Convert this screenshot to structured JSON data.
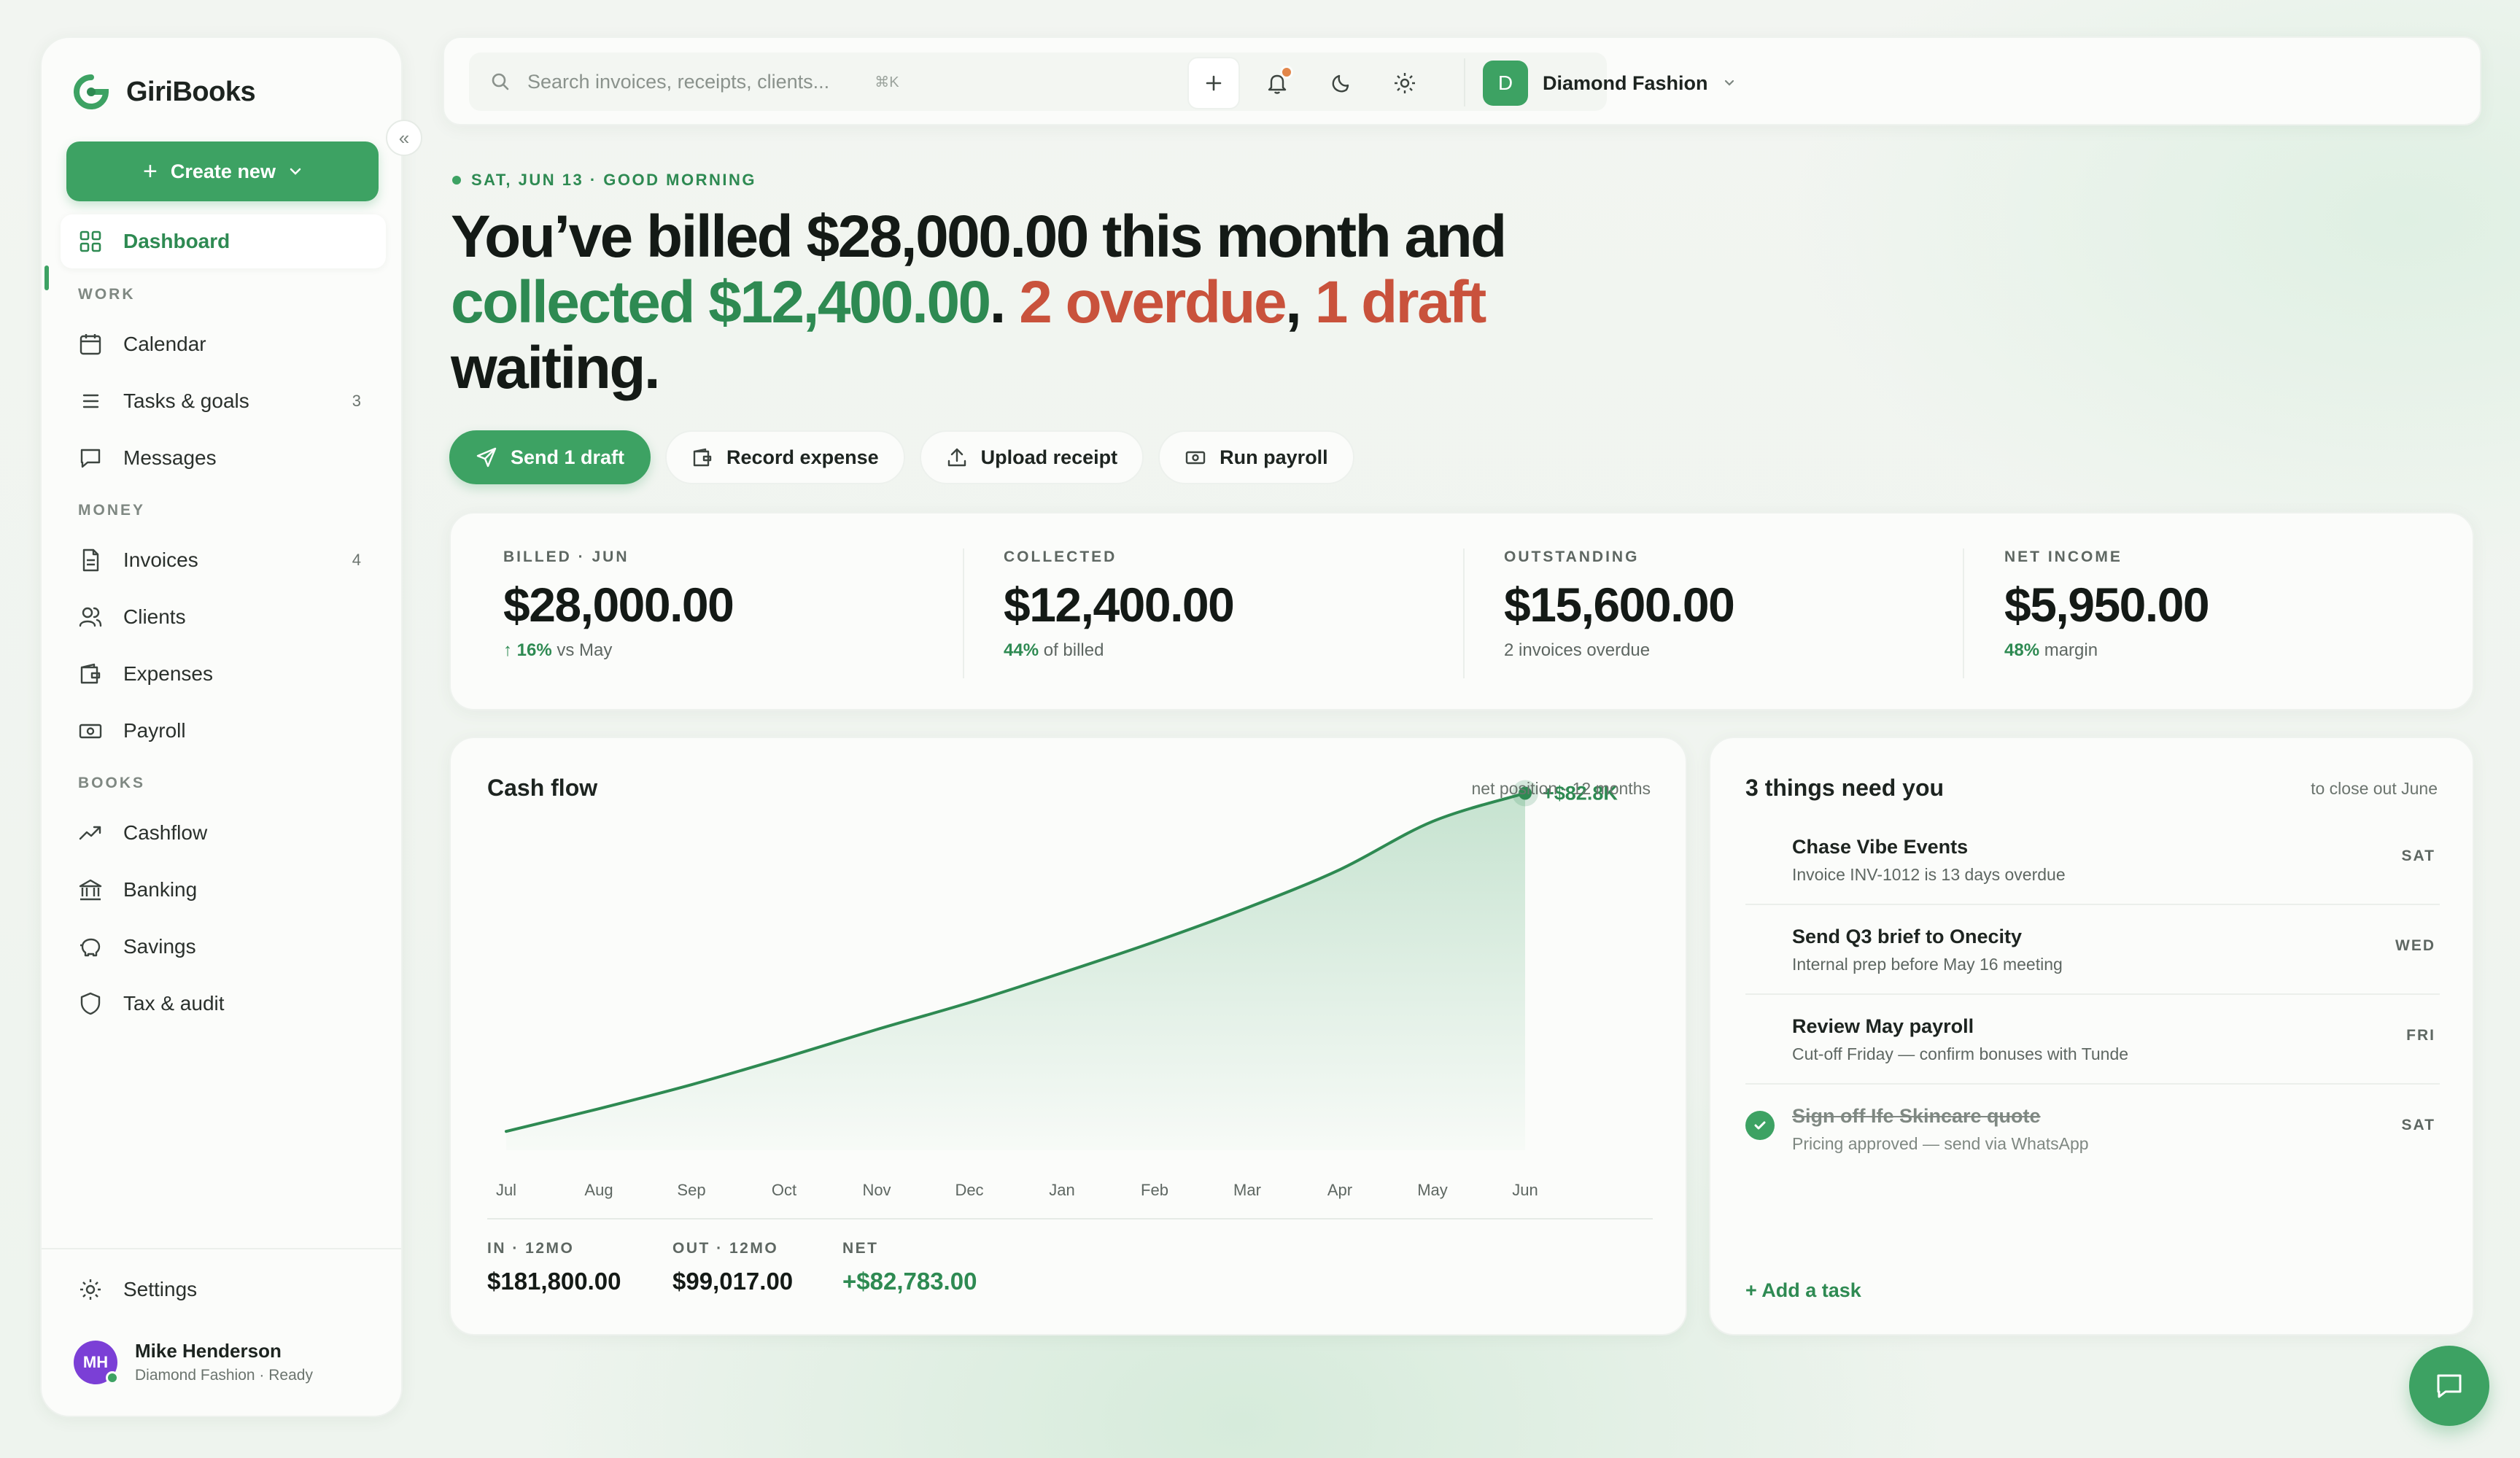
{
  "brand": {
    "name": "GiriBooks"
  },
  "sidebar": {
    "create_label": "Create new",
    "dashboard": "Dashboard",
    "sections": {
      "work": "WORK",
      "money": "MONEY",
      "books": "BOOKS"
    },
    "work_items": [
      {
        "label": "Calendar",
        "icon": "calendar-icon"
      },
      {
        "label": "Tasks & goals",
        "icon": "list-icon",
        "count": "3"
      },
      {
        "label": "Messages",
        "icon": "message-icon"
      }
    ],
    "money_items": [
      {
        "label": "Invoices",
        "icon": "document-icon",
        "count": "4"
      },
      {
        "label": "Clients",
        "icon": "users-icon"
      },
      {
        "label": "Expenses",
        "icon": "wallet-icon"
      },
      {
        "label": "Payroll",
        "icon": "banknote-icon"
      }
    ],
    "books_items": [
      {
        "label": "Cashflow",
        "icon": "trend-icon"
      },
      {
        "label": "Banking",
        "icon": "bank-icon"
      },
      {
        "label": "Savings",
        "icon": "piggy-icon"
      },
      {
        "label": "Tax & audit",
        "icon": "shield-icon"
      }
    ],
    "settings": "Settings",
    "user": {
      "initials": "MH",
      "name": "Mike Henderson",
      "sub": "Diamond Fashion · Ready"
    }
  },
  "topbar": {
    "search_placeholder": "Search invoices, receipts, clients...",
    "shortcut": "⌘K",
    "account_initial": "D",
    "account_name": "Diamond Fashion"
  },
  "hero": {
    "greeting": "SAT, JUN 13 · GOOD MORNING",
    "p1": "You’ve billed $28,000.00 this month and ",
    "p2": "collected $12,400.00",
    "p3": ". ",
    "p4": "2 overdue",
    "p5": ", ",
    "p6": "1 draft",
    "p7": " waiting."
  },
  "actions": {
    "send": "Send 1 draft",
    "expense": "Record expense",
    "receipt": "Upload receipt",
    "payroll": "Run payroll"
  },
  "stats": [
    {
      "label": "BILLED · JUN",
      "value": "$28,000.00",
      "highlight": "↑ 16%",
      "note": " vs May"
    },
    {
      "label": "COLLECTED",
      "value": "$12,400.00",
      "highlight": "44%",
      "note": " of billed"
    },
    {
      "label": "OUTSTANDING",
      "value": "$15,600.00",
      "highlight": "",
      "note": "2 invoices overdue"
    },
    {
      "label": "NET INCOME",
      "value": "$5,950.00",
      "highlight": "48%",
      "note": " margin"
    }
  ],
  "cashflow": {
    "title": "Cash flow",
    "note": "net position · 12 months",
    "end_label": "+$82.8K",
    "totals": [
      {
        "label": "IN · 12MO",
        "value": "$181,800.00"
      },
      {
        "label": "OUT · 12MO",
        "value": "$99,017.00"
      },
      {
        "label": "NET",
        "value": "+$82,783.00"
      }
    ]
  },
  "chart_data": {
    "type": "area",
    "title": "Cash flow",
    "categories": [
      "Jul",
      "Aug",
      "Sep",
      "Oct",
      "Nov",
      "Dec",
      "Jan",
      "Feb",
      "Mar",
      "Apr",
      "May",
      "Jun"
    ],
    "series": [
      {
        "values": [
          1.5,
          9.5,
          18.0,
          27.5,
          37.5,
          47.0,
          57.5,
          68.5,
          80.5,
          94.0,
          111.0,
          121.0
        ]
      }
    ],
    "ylim": [
      0,
      125
    ],
    "end_point_label": "+$82.8K",
    "color": "#2e8a52",
    "grid": false
  },
  "tasks": {
    "title": "3 things need you",
    "note": "to close out June",
    "items": [
      {
        "title": "Chase Vibe Events",
        "sub": "Invoice INV-1012 is 13 days overdue",
        "day": "SAT",
        "done": false
      },
      {
        "title": "Send Q3 brief to Onecity",
        "sub": "Internal prep before May 16 meeting",
        "day": "WED",
        "done": false
      },
      {
        "title": "Review May payroll",
        "sub": "Cut-off Friday — confirm bonuses with Tunde",
        "day": "FRI",
        "done": false
      },
      {
        "title": "Sign off Ife Skincare quote",
        "sub": "Pricing approved — send via WhatsApp",
        "day": "SAT",
        "done": true
      }
    ],
    "add_label": "+ Add a task"
  },
  "colors": {
    "accent": "#3da263",
    "accent_dark": "#2e8a52",
    "alert": "#c9523c"
  }
}
